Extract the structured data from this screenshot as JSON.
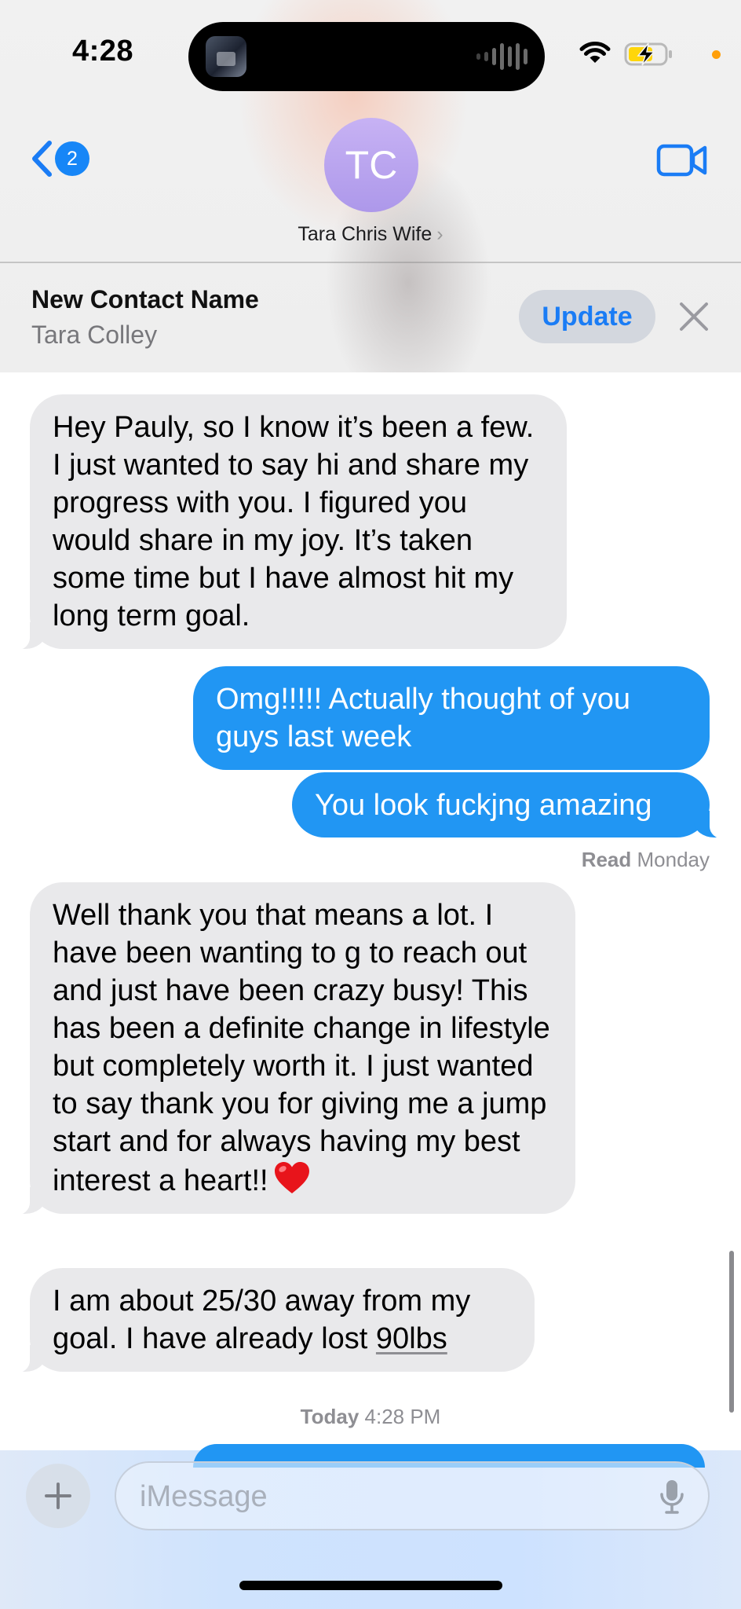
{
  "status_bar": {
    "time": "4:28"
  },
  "header": {
    "back_badge_count": "2",
    "avatar_initials": "TC",
    "contact_name": "Tara Chris Wife",
    "contact_chevron": "›"
  },
  "banner": {
    "title": "New Contact Name",
    "name": "Tara Colley",
    "update_label": "Update"
  },
  "messages": [
    {
      "direction": "incoming",
      "text": "Hey Pauly, so I know it’s been a few. I just wanted to say hi and share my progress with you. I figured you would share in my joy. It’s taken some time but I have almost hit my long term goal."
    },
    {
      "direction": "outgoing",
      "text": "Omg!!!!!  Actually thought of you guys last week"
    },
    {
      "direction": "outgoing",
      "text": "You look fuckjng amazing"
    },
    {
      "direction": "incoming",
      "text": "Well thank you that means a lot. I have been wanting to g to reach out and just have been crazy busy! This has been a definite change in lifestyle but completely worth it. I just wanted to say thank you for giving me a jump start and for always having my best interest a heart!!",
      "emoji": "red-heart"
    },
    {
      "direction": "incoming",
      "text_before_link": "I am about 25/30 away from my goal. I have already lost ",
      "link_text": "90lbs"
    }
  ],
  "read_receipt": {
    "label": "Read",
    "day": "Monday"
  },
  "day_stamp": {
    "day": "Today",
    "time": "4:28 PM"
  },
  "composer": {
    "placeholder": "iMessage"
  },
  "colors": {
    "outgoing_bubble": "#2196f3",
    "incoming_bubble": "#e9e9eb",
    "accent": "#1a7cf5",
    "avatar": "#b9a3ef"
  },
  "icons": [
    "back-chevron-icon",
    "video-camera-icon",
    "close-icon",
    "plus-icon",
    "microphone-icon",
    "wifi-icon",
    "battery-charging-icon",
    "waveform-icon",
    "heart-emoji"
  ]
}
